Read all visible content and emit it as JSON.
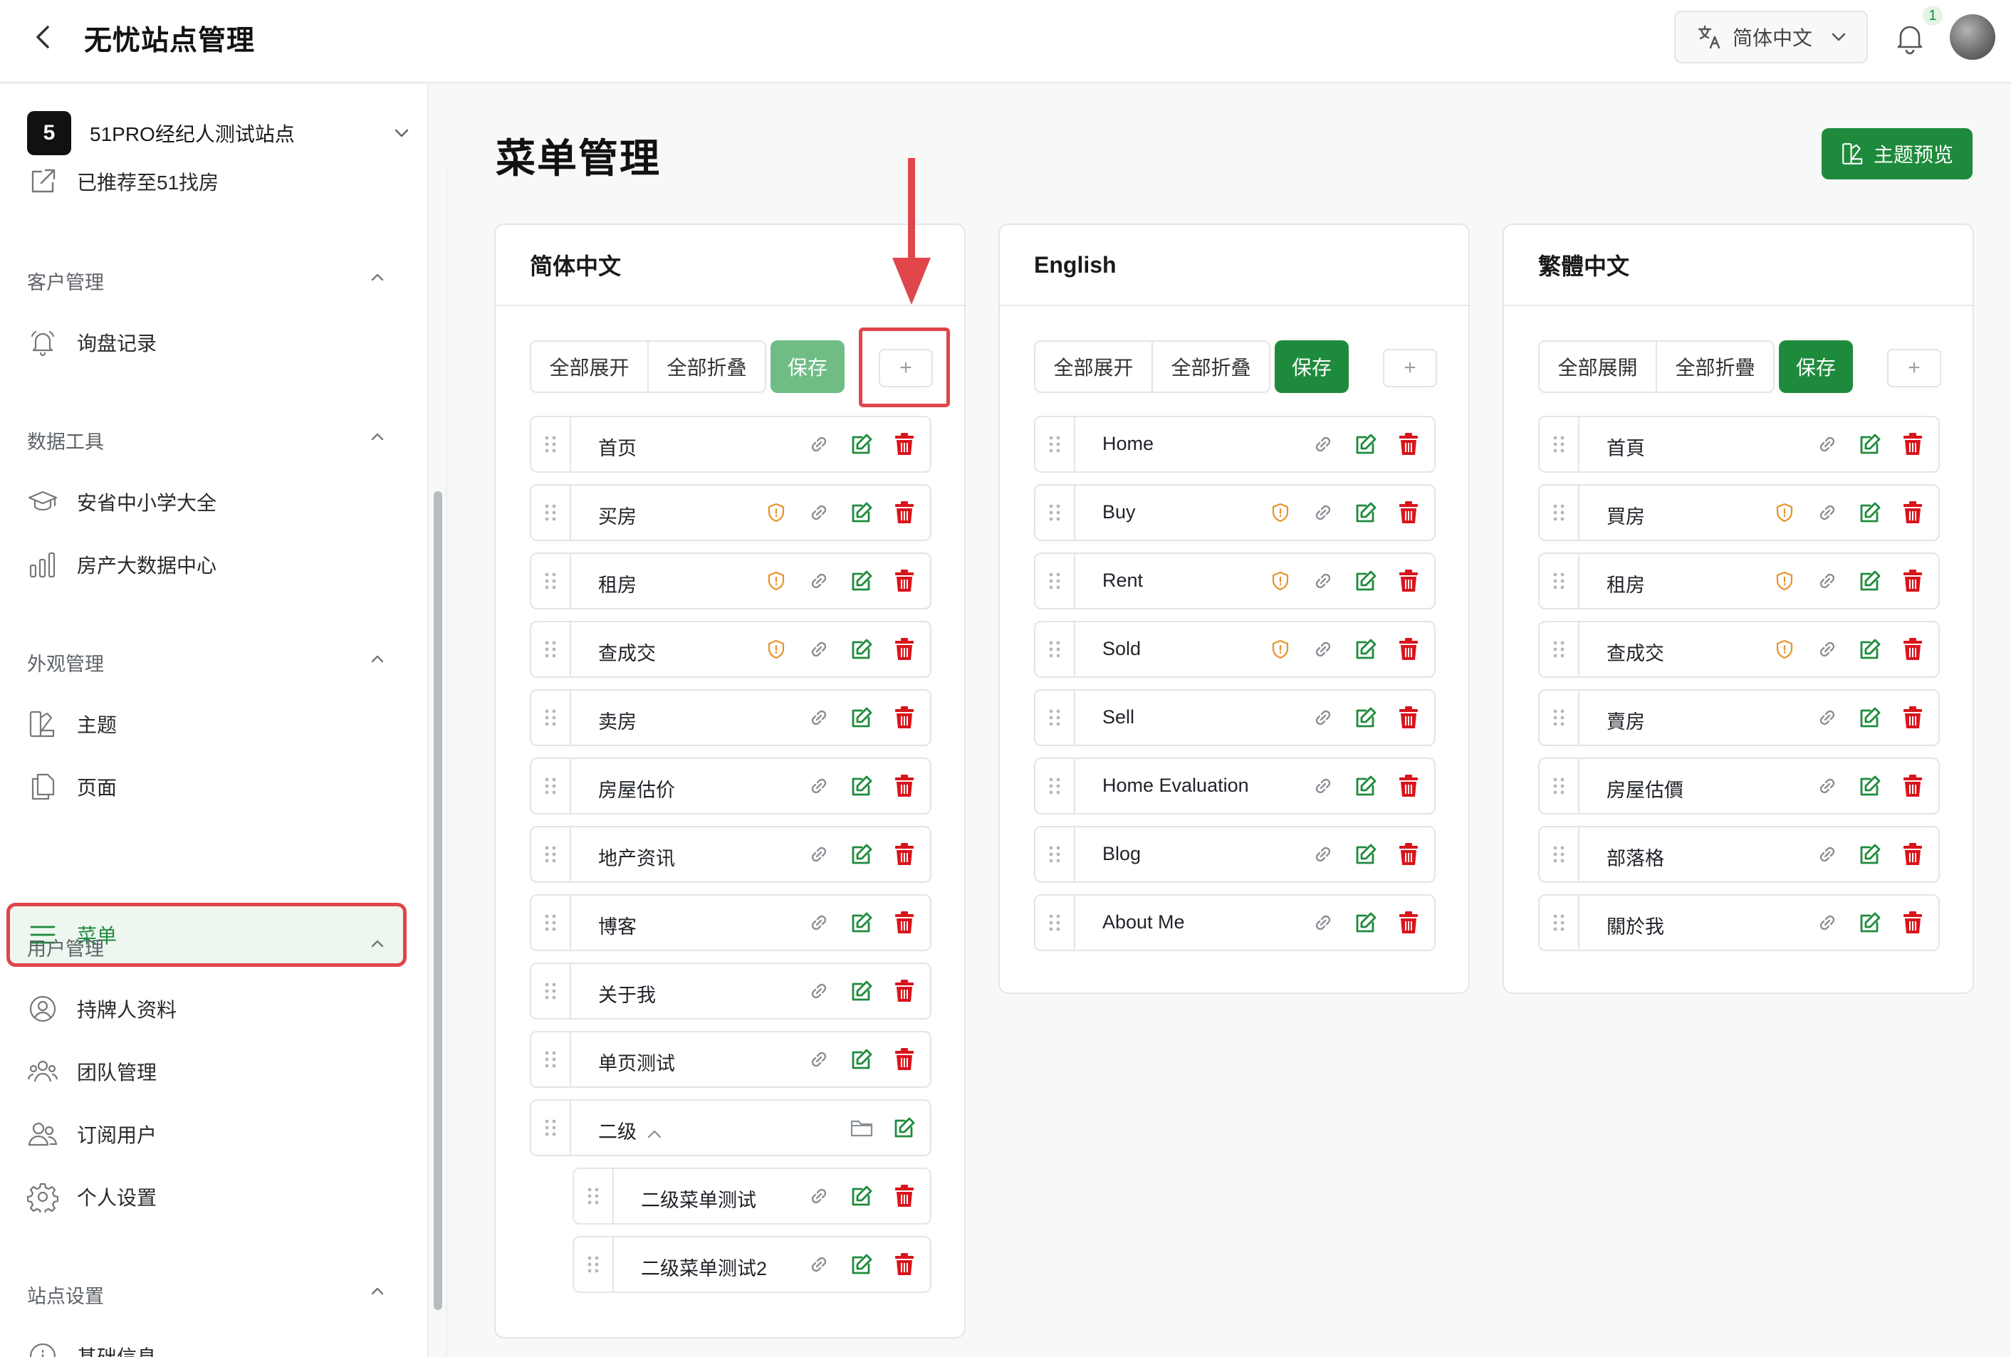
{
  "header": {
    "title": "无忧站点管理",
    "language": "简体中文",
    "notification_count": "1"
  },
  "sidebar": {
    "site_badge": "5",
    "site_name": "51PRO经纪人测试站点",
    "recommended": "已推荐至51找房",
    "sections": {
      "customer": {
        "title": "客户管理",
        "items": [
          "询盘记录"
        ]
      },
      "data": {
        "title": "数据工具",
        "items": [
          "安省中小学大全",
          "房产大数据中心"
        ]
      },
      "appearance": {
        "title": "外观管理",
        "items": [
          "主题",
          "页面",
          "菜单"
        ]
      },
      "users": {
        "title": "用户管理",
        "items": [
          "持牌人资料",
          "团队管理",
          "订阅用户",
          "个人设置"
        ]
      },
      "site": {
        "title": "站点设置",
        "items": [
          "基础信息"
        ]
      }
    }
  },
  "main": {
    "title": "菜单管理",
    "preview_button": "主题预览",
    "panels": [
      {
        "title": "简体中文",
        "expand_all": "全部展开",
        "collapse_all": "全部折叠",
        "save": "保存",
        "add": "+",
        "items": [
          "首页",
          "买房",
          "租房",
          "查成交",
          "卖房",
          "房屋估价",
          "地产资讯",
          "博客",
          "关于我",
          "单页测试",
          "二级"
        ],
        "sub_items": [
          "二级菜单测试",
          "二级菜单测试2"
        ]
      },
      {
        "title": "English",
        "expand_all": "全部展开",
        "collapse_all": "全部折叠",
        "save": "保存",
        "add": "+",
        "items": [
          "Home",
          "Buy",
          "Rent",
          "Sold",
          "Sell",
          "Home Evaluation",
          "Blog",
          "About Me"
        ]
      },
      {
        "title": "繁體中文",
        "expand_all": "全部展開",
        "collapse_all": "全部折疊",
        "save": "保存",
        "add": "+",
        "items": [
          "首頁",
          "買房",
          "租房",
          "查成交",
          "賣房",
          "房屋估價",
          "部落格",
          "關於我"
        ]
      }
    ]
  },
  "colors": {
    "accent": "#1e8b3c",
    "danger": "#d9141b",
    "warning": "#e8922a",
    "highlight": "#e0464b"
  }
}
